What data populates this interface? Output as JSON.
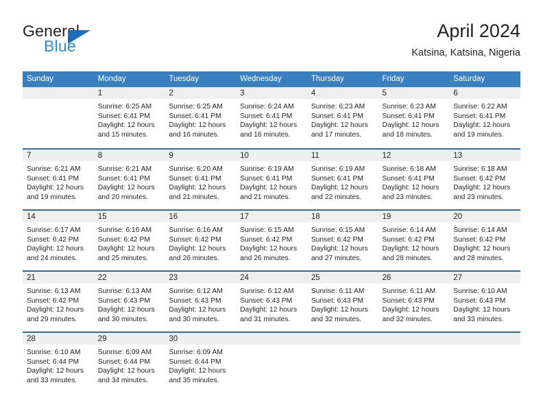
{
  "brand": {
    "name_part1": "General",
    "name_part2": "Blue",
    "triangle_icon": "triangle-icon",
    "accent_color": "#1b6cb5",
    "accent_color_light": "#2e8bd4"
  },
  "header": {
    "title": "April 2024",
    "subtitle": "Katsina, Katsina, Nigeria"
  },
  "theme": {
    "header_bg": "#3a7fbf",
    "week_divider": "#2f6ba6",
    "day_band_bg": "#efefef",
    "text": "#231f20"
  },
  "weekday_headers": [
    "Sunday",
    "Monday",
    "Tuesday",
    "Wednesday",
    "Thursday",
    "Friday",
    "Saturday"
  ],
  "labels": {
    "sunrise_prefix": "Sunrise:",
    "sunset_prefix": "Sunset:",
    "daylight_prefix": "Daylight:"
  },
  "weeks": [
    [
      {
        "day": "",
        "line1": "",
        "line2": "",
        "line3": "",
        "line4": ""
      },
      {
        "day": "1",
        "line1": "Sunrise: 6:25 AM",
        "line2": "Sunset: 6:41 PM",
        "line3": "Daylight: 12 hours",
        "line4": "and 15 minutes."
      },
      {
        "day": "2",
        "line1": "Sunrise: 6:25 AM",
        "line2": "Sunset: 6:41 PM",
        "line3": "Daylight: 12 hours",
        "line4": "and 16 minutes."
      },
      {
        "day": "3",
        "line1": "Sunrise: 6:24 AM",
        "line2": "Sunset: 6:41 PM",
        "line3": "Daylight: 12 hours",
        "line4": "and 16 minutes."
      },
      {
        "day": "4",
        "line1": "Sunrise: 6:23 AM",
        "line2": "Sunset: 6:41 PM",
        "line3": "Daylight: 12 hours",
        "line4": "and 17 minutes."
      },
      {
        "day": "5",
        "line1": "Sunrise: 6:23 AM",
        "line2": "Sunset: 6:41 PM",
        "line3": "Daylight: 12 hours",
        "line4": "and 18 minutes."
      },
      {
        "day": "6",
        "line1": "Sunrise: 6:22 AM",
        "line2": "Sunset: 6:41 PM",
        "line3": "Daylight: 12 hours",
        "line4": "and 19 minutes."
      }
    ],
    [
      {
        "day": "7",
        "line1": "Sunrise: 6:21 AM",
        "line2": "Sunset: 6:41 PM",
        "line3": "Daylight: 12 hours",
        "line4": "and 19 minutes."
      },
      {
        "day": "8",
        "line1": "Sunrise: 6:21 AM",
        "line2": "Sunset: 6:41 PM",
        "line3": "Daylight: 12 hours",
        "line4": "and 20 minutes."
      },
      {
        "day": "9",
        "line1": "Sunrise: 6:20 AM",
        "line2": "Sunset: 6:41 PM",
        "line3": "Daylight: 12 hours",
        "line4": "and 21 minutes."
      },
      {
        "day": "10",
        "line1": "Sunrise: 6:19 AM",
        "line2": "Sunset: 6:41 PM",
        "line3": "Daylight: 12 hours",
        "line4": "and 21 minutes."
      },
      {
        "day": "11",
        "line1": "Sunrise: 6:19 AM",
        "line2": "Sunset: 6:41 PM",
        "line3": "Daylight: 12 hours",
        "line4": "and 22 minutes."
      },
      {
        "day": "12",
        "line1": "Sunrise: 6:18 AM",
        "line2": "Sunset: 6:41 PM",
        "line3": "Daylight: 12 hours",
        "line4": "and 23 minutes."
      },
      {
        "day": "13",
        "line1": "Sunrise: 6:18 AM",
        "line2": "Sunset: 6:42 PM",
        "line3": "Daylight: 12 hours",
        "line4": "and 23 minutes."
      }
    ],
    [
      {
        "day": "14",
        "line1": "Sunrise: 6:17 AM",
        "line2": "Sunset: 6:42 PM",
        "line3": "Daylight: 12 hours",
        "line4": "and 24 minutes."
      },
      {
        "day": "15",
        "line1": "Sunrise: 6:16 AM",
        "line2": "Sunset: 6:42 PM",
        "line3": "Daylight: 12 hours",
        "line4": "and 25 minutes."
      },
      {
        "day": "16",
        "line1": "Sunrise: 6:16 AM",
        "line2": "Sunset: 6:42 PM",
        "line3": "Daylight: 12 hours",
        "line4": "and 26 minutes."
      },
      {
        "day": "17",
        "line1": "Sunrise: 6:15 AM",
        "line2": "Sunset: 6:42 PM",
        "line3": "Daylight: 12 hours",
        "line4": "and 26 minutes."
      },
      {
        "day": "18",
        "line1": "Sunrise: 6:15 AM",
        "line2": "Sunset: 6:42 PM",
        "line3": "Daylight: 12 hours",
        "line4": "and 27 minutes."
      },
      {
        "day": "19",
        "line1": "Sunrise: 6:14 AM",
        "line2": "Sunset: 6:42 PM",
        "line3": "Daylight: 12 hours",
        "line4": "and 28 minutes."
      },
      {
        "day": "20",
        "line1": "Sunrise: 6:14 AM",
        "line2": "Sunset: 6:42 PM",
        "line3": "Daylight: 12 hours",
        "line4": "and 28 minutes."
      }
    ],
    [
      {
        "day": "21",
        "line1": "Sunrise: 6:13 AM",
        "line2": "Sunset: 6:42 PM",
        "line3": "Daylight: 12 hours",
        "line4": "and 29 minutes."
      },
      {
        "day": "22",
        "line1": "Sunrise: 6:13 AM",
        "line2": "Sunset: 6:43 PM",
        "line3": "Daylight: 12 hours",
        "line4": "and 30 minutes."
      },
      {
        "day": "23",
        "line1": "Sunrise: 6:12 AM",
        "line2": "Sunset: 6:43 PM",
        "line3": "Daylight: 12 hours",
        "line4": "and 30 minutes."
      },
      {
        "day": "24",
        "line1": "Sunrise: 6:12 AM",
        "line2": "Sunset: 6:43 PM",
        "line3": "Daylight: 12 hours",
        "line4": "and 31 minutes."
      },
      {
        "day": "25",
        "line1": "Sunrise: 6:11 AM",
        "line2": "Sunset: 6:43 PM",
        "line3": "Daylight: 12 hours",
        "line4": "and 32 minutes."
      },
      {
        "day": "26",
        "line1": "Sunrise: 6:11 AM",
        "line2": "Sunset: 6:43 PM",
        "line3": "Daylight: 12 hours",
        "line4": "and 32 minutes."
      },
      {
        "day": "27",
        "line1": "Sunrise: 6:10 AM",
        "line2": "Sunset: 6:43 PM",
        "line3": "Daylight: 12 hours",
        "line4": "and 33 minutes."
      }
    ],
    [
      {
        "day": "28",
        "line1": "Sunrise: 6:10 AM",
        "line2": "Sunset: 6:44 PM",
        "line3": "Daylight: 12 hours",
        "line4": "and 33 minutes."
      },
      {
        "day": "29",
        "line1": "Sunrise: 6:09 AM",
        "line2": "Sunset: 6:44 PM",
        "line3": "Daylight: 12 hours",
        "line4": "and 34 minutes."
      },
      {
        "day": "30",
        "line1": "Sunrise: 6:09 AM",
        "line2": "Sunset: 6:44 PM",
        "line3": "Daylight: 12 hours",
        "line4": "and 35 minutes."
      },
      {
        "day": "",
        "line1": "",
        "line2": "",
        "line3": "",
        "line4": ""
      },
      {
        "day": "",
        "line1": "",
        "line2": "",
        "line3": "",
        "line4": ""
      },
      {
        "day": "",
        "line1": "",
        "line2": "",
        "line3": "",
        "line4": ""
      },
      {
        "day": "",
        "line1": "",
        "line2": "",
        "line3": "",
        "line4": ""
      }
    ]
  ]
}
